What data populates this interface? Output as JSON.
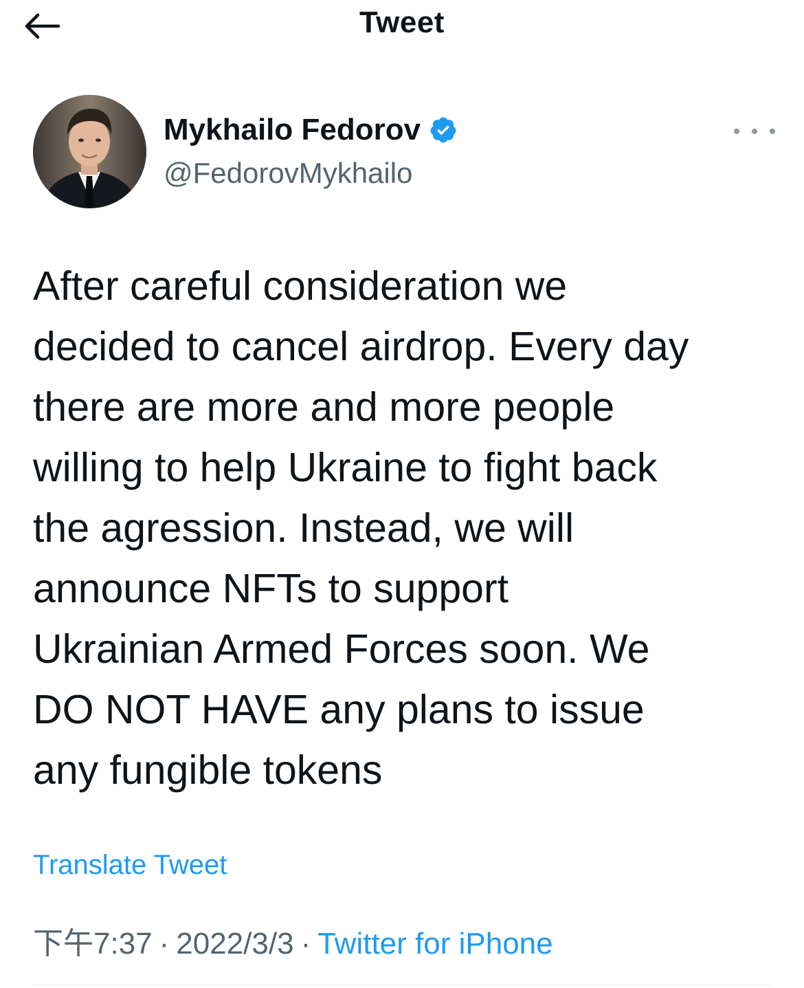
{
  "header": {
    "title": "Tweet",
    "back_icon": "arrow-left-icon"
  },
  "author": {
    "display_name": "Mykhailo Fedorov",
    "handle": "@FedorovMykhailo",
    "verified": true,
    "verified_icon": "verified-badge-icon",
    "more_icon": "more-horizontal-icon"
  },
  "tweet": {
    "text": "After careful consideration we\ndecided to cancel airdrop. Every day\nthere are more and more people\nwilling to help Ukraine to fight back\nthe agression. Instead, we will\nannounce NFTs to support\nUkrainian Armed Forces soon. We\nDO NOT HAVE any plans to issue\nany fungible tokens"
  },
  "actions": {
    "translate_label": "Translate Tweet"
  },
  "meta": {
    "time": "下午7:37",
    "date": "2022/3/3",
    "separator": "·",
    "source": "Twitter for iPhone"
  },
  "colors": {
    "accent": "#1d9bf0",
    "text_primary": "#0f1419",
    "text_secondary": "#536471"
  }
}
